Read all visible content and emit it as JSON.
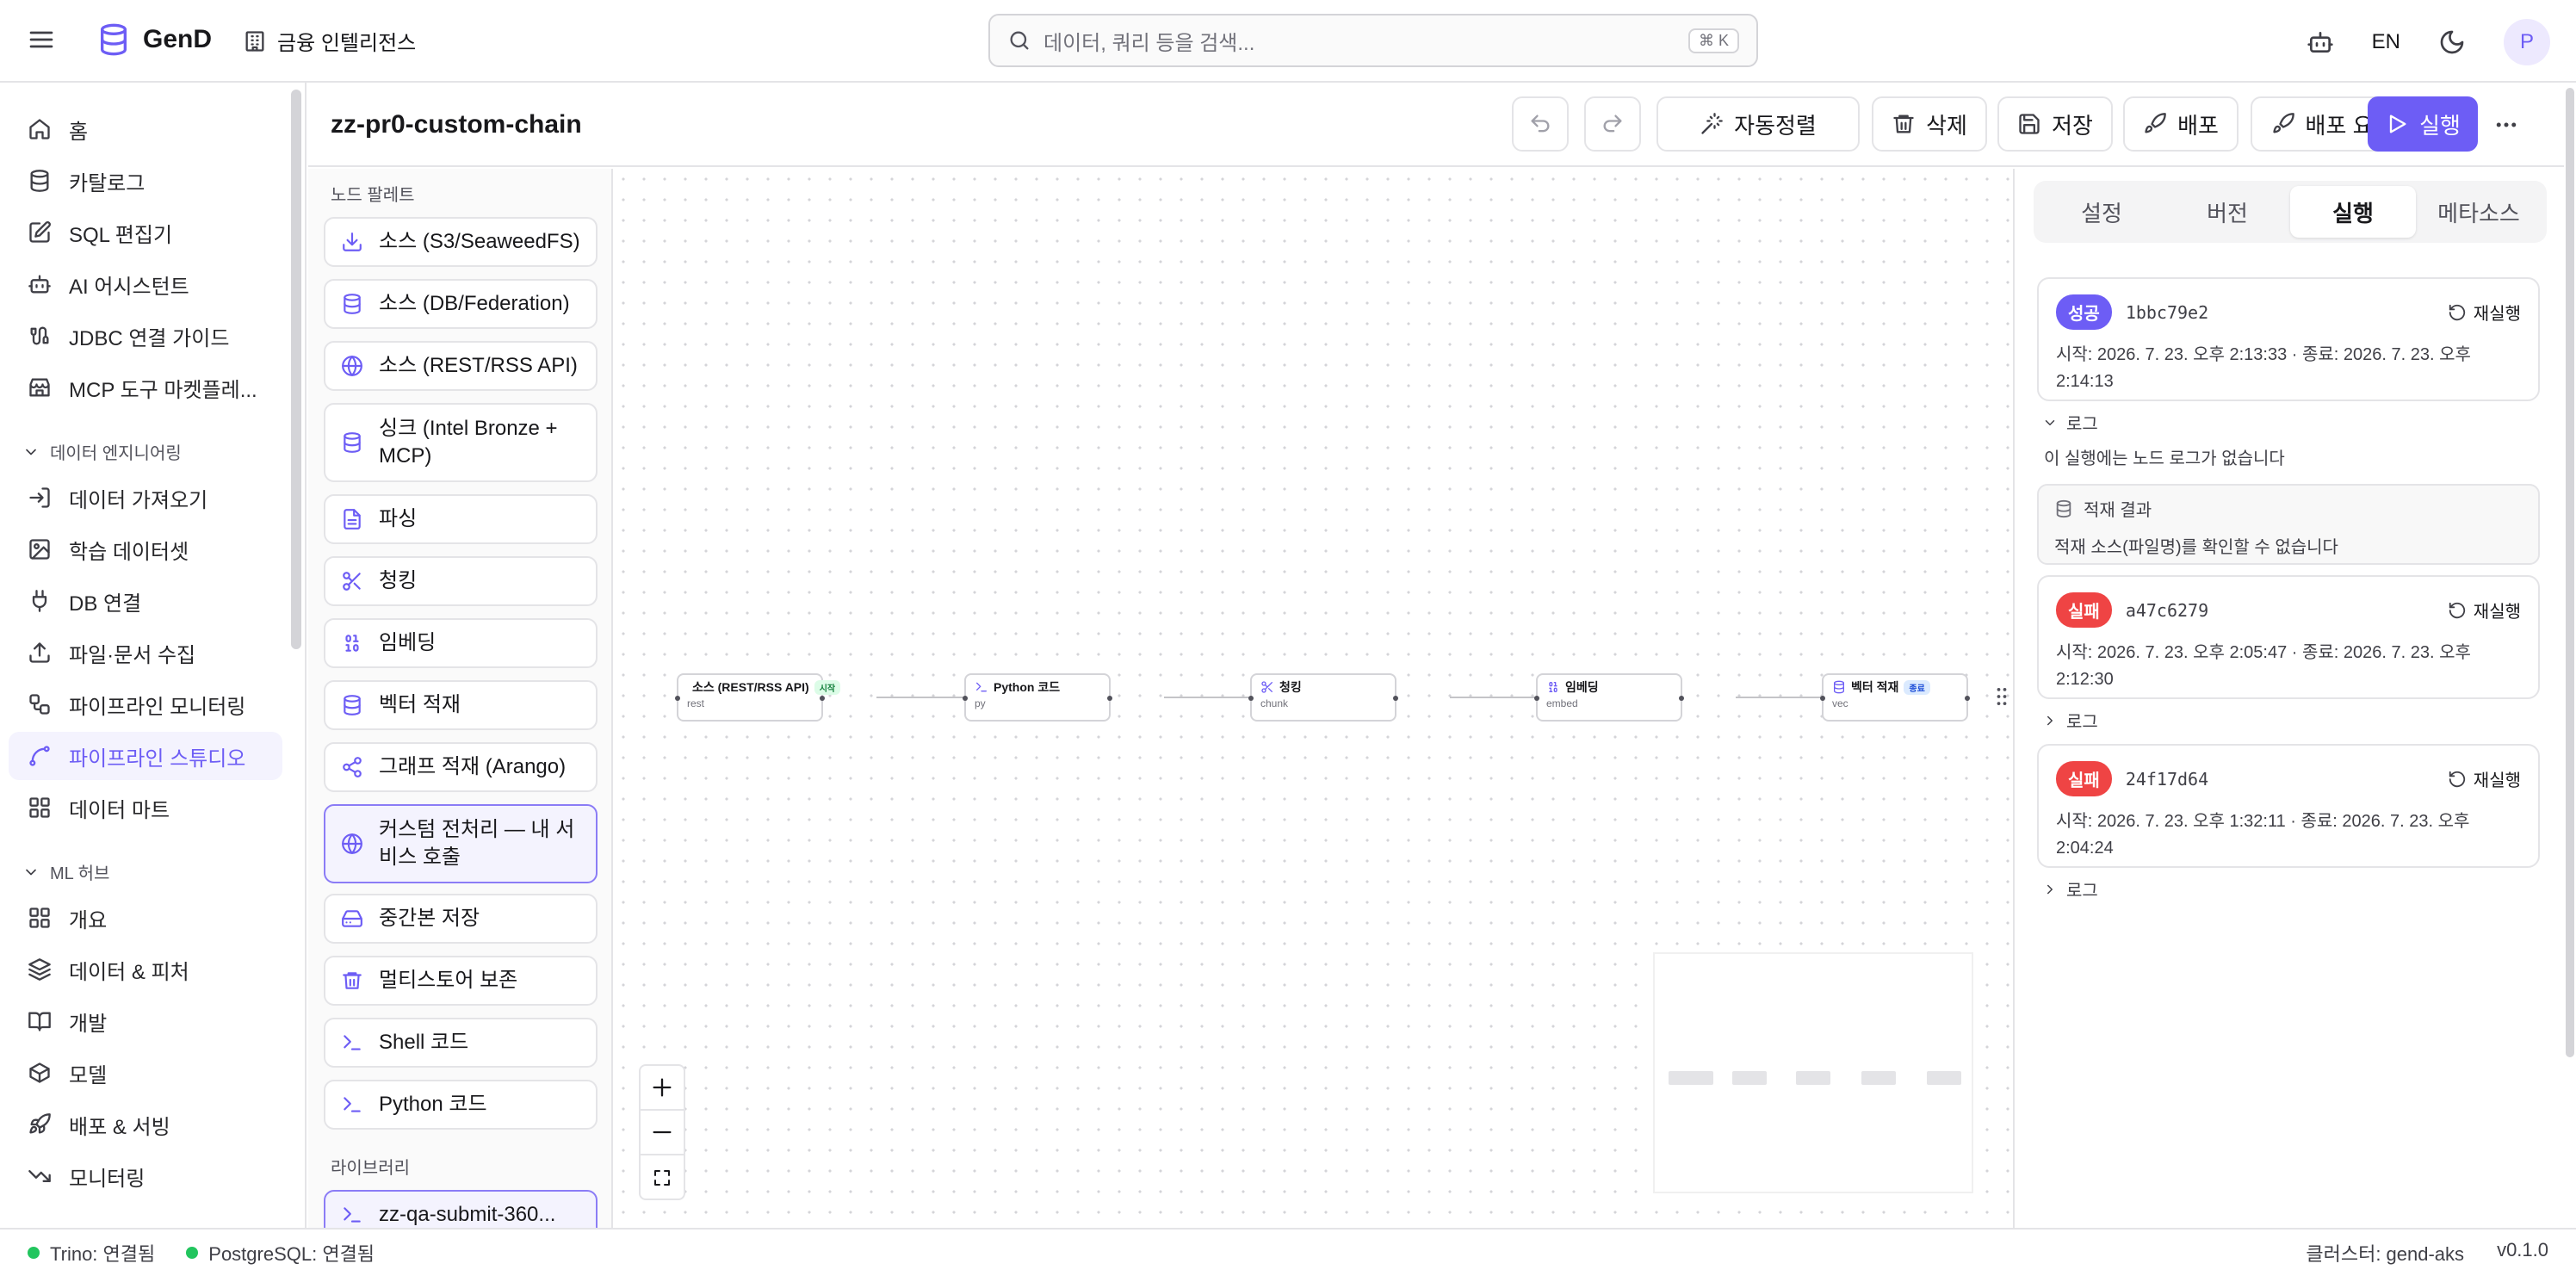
{
  "app": {
    "name": "GenD",
    "org": "금융 인텔리전스"
  },
  "search": {
    "placeholder": "데이터, 쿼리 등을 검색...",
    "shortcut": "⌘ K"
  },
  "topbar": {
    "lang": "EN",
    "avatar": "P"
  },
  "sidebar": {
    "items": [
      {
        "label": "홈",
        "icon": "home-icon"
      },
      {
        "label": "카탈로그",
        "icon": "database-icon"
      },
      {
        "label": "SQL 편집기",
        "icon": "edit-icon"
      },
      {
        "label": "AI 어시스턴트",
        "icon": "bot-icon"
      },
      {
        "label": "JDBC 연결 가이드",
        "icon": "cable-icon"
      },
      {
        "label": "MCP 도구 마켓플레...",
        "icon": "store-icon"
      }
    ],
    "sections": [
      {
        "title": "데이터 엔지니어링",
        "items": [
          {
            "label": "데이터 가져오기",
            "icon": "import-icon"
          },
          {
            "label": "학습 데이터셋",
            "icon": "images-icon"
          },
          {
            "label": "DB 연결",
            "icon": "plug-icon"
          },
          {
            "label": "파일·문서 수집",
            "icon": "upload-icon"
          },
          {
            "label": "파이프라인 모니터링",
            "icon": "workflow-icon"
          },
          {
            "label": "파이프라인 스튜디오",
            "icon": "spline-icon",
            "active": true
          },
          {
            "label": "데이터 마트",
            "icon": "grid-icon"
          }
        ]
      },
      {
        "title": "ML 허브",
        "items": [
          {
            "label": "개요",
            "icon": "grid-icon"
          },
          {
            "label": "데이터 & 피처",
            "icon": "layers-icon"
          },
          {
            "label": "개발",
            "icon": "book-icon"
          },
          {
            "label": "모델",
            "icon": "box-icon"
          },
          {
            "label": "배포 & 서빙",
            "icon": "rocket-icon"
          },
          {
            "label": "모니터링",
            "icon": "trending-icon"
          }
        ]
      }
    ]
  },
  "editor": {
    "pipeline_name": "zz-pr0-custom-chain",
    "toolbar": {
      "auto_layout": "자동정렬",
      "delete": "삭제",
      "save": "저장",
      "deploy": "배포",
      "deploy_request": "배포 요청",
      "run": "실행"
    }
  },
  "palette": {
    "title": "노드 팔레트",
    "items": [
      {
        "label": "소스 (S3/SeaweedFS)",
        "icon": "download-icon"
      },
      {
        "label": "소스 (DB/Federation)",
        "icon": "database-icon"
      },
      {
        "label": "소스 (REST/RSS API)",
        "icon": "globe-icon"
      },
      {
        "label": "싱크 (Intel Bronze + MCP)",
        "icon": "database-icon"
      },
      {
        "label": "파싱",
        "icon": "file-text-icon"
      },
      {
        "label": "청킹",
        "icon": "scissors-icon"
      },
      {
        "label": "임베딩",
        "icon": "binary-icon"
      },
      {
        "label": "벡터 적재",
        "icon": "database-icon"
      },
      {
        "label": "그래프 적재 (Arango)",
        "icon": "share-icon"
      },
      {
        "label": "커스텀 전처리 — 내 서비스 호출",
        "icon": "globe-icon",
        "selected": true
      },
      {
        "label": "중간본 저장",
        "icon": "hard-drive-icon"
      },
      {
        "label": "멀티스토어 보존",
        "icon": "trash-icon"
      },
      {
        "label": "Shell 코드",
        "icon": "terminal-icon"
      },
      {
        "label": "Python 코드",
        "icon": "terminal-icon"
      }
    ],
    "library_title": "라이브러리",
    "library_items": [
      {
        "label": "zz-qa-submit-360...",
        "icon": "terminal-icon"
      }
    ]
  },
  "canvas": {
    "nodes": [
      {
        "label": "소스 (REST/RSS API)",
        "sub": "rest",
        "badge": "시작",
        "icon": "globe-icon"
      },
      {
        "label": "Python 코드",
        "sub": "py",
        "badge": "",
        "icon": "terminal-icon"
      },
      {
        "label": "청킹",
        "sub": "chunk",
        "badge": "",
        "icon": "scissors-icon"
      },
      {
        "label": "임베딩",
        "sub": "embed",
        "badge": "",
        "icon": "binary-icon"
      },
      {
        "label": "벡터 적재",
        "sub": "vec",
        "badge": "종료",
        "icon": "database-icon"
      }
    ]
  },
  "panel": {
    "tabs": [
      "설정",
      "버전",
      "실행",
      "메타소스"
    ],
    "active_tab": 2,
    "runs": [
      {
        "status": "성공",
        "status_kind": "success",
        "id": "1bbc79e2",
        "rerun": "재실행",
        "time": "시작: 2026. 7. 23. 오후 2:13:33 · 종료: 2026. 7. 23. 오후 2:14:13"
      },
      {
        "status": "실패",
        "status_kind": "fail",
        "id": "a47c6279",
        "rerun": "재실행",
        "time": "시작: 2026. 7. 23. 오후 2:05:47 · 종료: 2026. 7. 23. 오후 2:12:30"
      },
      {
        "status": "실패",
        "status_kind": "fail",
        "id": "24f17d64",
        "rerun": "재실행",
        "time": "시작: 2026. 7. 23. 오후 1:32:11 · 종료: 2026. 7. 23. 오후 2:04:24"
      }
    ],
    "log_label": "로그",
    "no_log_msg": "이 실행에는 노드 로그가 없습니다",
    "sink_title": "적재 결과",
    "sink_msg": "적재 소스(파일명)를 확인할 수 없습니다"
  },
  "status": {
    "trino": "Trino: 연결됨",
    "postgres": "PostgreSQL: 연결됨",
    "cluster": "클러스터: gend-aks",
    "version": "v0.1.0"
  },
  "colors": {
    "accent": "#6d5df5",
    "success": "#22c55e",
    "fail": "#ef4444"
  }
}
